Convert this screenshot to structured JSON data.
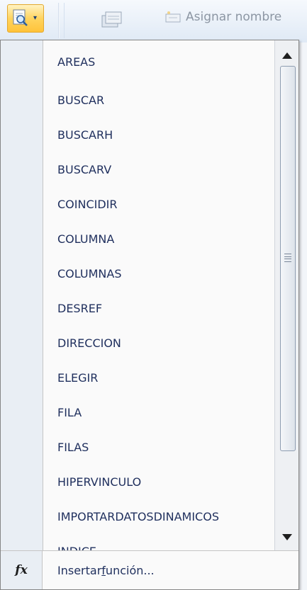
{
  "ribbon": {
    "name_manager_label": "Asignar nombre",
    "accent": "#ffc33a"
  },
  "menu": {
    "items": [
      {
        "label": "AREAS"
      },
      {
        "label": "BUSCAR"
      },
      {
        "label": "BUSCARH"
      },
      {
        "label": "BUSCARV"
      },
      {
        "label": "COINCIDIR"
      },
      {
        "label": "COLUMNA"
      },
      {
        "label": "COLUMNAS"
      },
      {
        "label": "DESREF"
      },
      {
        "label": "DIRECCION"
      },
      {
        "label": "ELEGIR"
      },
      {
        "label": "FILA"
      },
      {
        "label": "FILAS"
      },
      {
        "label": "HIPERVINCULO"
      },
      {
        "label": "IMPORTARDATOSDINAMICOS"
      },
      {
        "label": "INDICE"
      }
    ],
    "footer": {
      "fx_symbol": "fx",
      "insert_prefix": "Insertar ",
      "insert_accel": "f",
      "insert_suffix": "unción..."
    },
    "text_color": "#1f2f5d"
  },
  "icons": {
    "lookup": "lookup-reference-icon",
    "dropdown": "chevron-down-icon",
    "scroll_up": "scroll-up-arrow-icon",
    "scroll_down": "scroll-down-arrow-icon",
    "fx": "function-icon"
  }
}
